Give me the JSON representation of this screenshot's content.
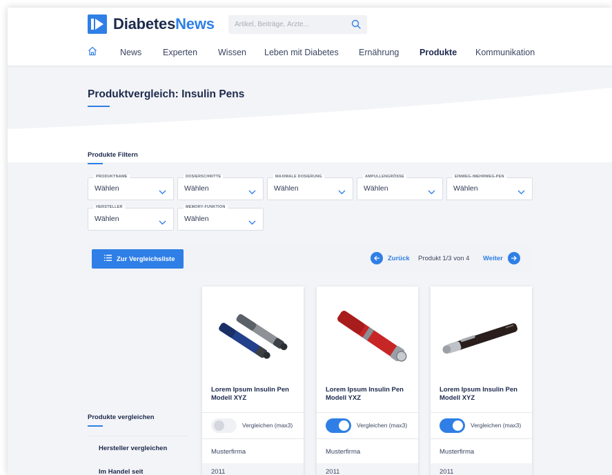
{
  "brand": {
    "name_part1": "Diabetes",
    "name_part2": "News",
    "color": "#2f7fe6"
  },
  "search": {
    "placeholder": "Artikel, Beiträge, Ärzte...",
    "icon": "search-icon"
  },
  "nav": {
    "home_icon": "home-icon",
    "items": [
      {
        "label": "News"
      },
      {
        "label": "Experten"
      },
      {
        "label": "Wissen"
      },
      {
        "label": "Leben mit Diabetes"
      },
      {
        "label": "Ernährung"
      },
      {
        "label": "Produkte",
        "active": true
      },
      {
        "label": "Kommunikation"
      }
    ]
  },
  "page": {
    "title": "Produktvergleich: Insulin Pens"
  },
  "filters": {
    "title": "Produkte Filtern",
    "items": [
      {
        "label": "PRODUKTNAME",
        "value": "Wählen"
      },
      {
        "label": "DOSIERSCHRITTE",
        "value": "Wählen"
      },
      {
        "label": "MAXIMALE DOSIERUNG",
        "value": "Wählen"
      },
      {
        "label": "AMPULLENGRÖSSE",
        "value": "Wählen"
      },
      {
        "label": "EINWEG-/MEHRWEG-PEN",
        "value": "Wählen"
      },
      {
        "label": "HERSTELLER",
        "value": "Wählen"
      },
      {
        "label": "MEMORY-FUNKTION",
        "value": "Wählen"
      }
    ]
  },
  "toolbar": {
    "compare_list_label": "Zur Vergleichsliste",
    "back_label": "Zurück",
    "pager_info": "Produkt 1/3 von 4",
    "next_label": "Weiter"
  },
  "sidebar": {
    "title": "Produkte vergleichen",
    "rows": [
      {
        "label": "Hersteller vergleichen"
      },
      {
        "label": "Im Handel seit"
      }
    ]
  },
  "products": [
    {
      "name": "Lorem Ipsum Insulin Pen Modell XYZ",
      "compare_label": "Vergleichen (max3)",
      "compare_on": false,
      "manufacturer": "Musterfirma",
      "since": "2011"
    },
    {
      "name": "Lorem Ipsum Insulin Pen Modell YXZ",
      "compare_label": "Vergleichen (max3)",
      "compare_on": true,
      "manufacturer": "Musterfirma",
      "since": "2011"
    },
    {
      "name": "Lorem Ipsum Insulin Pen Modell XYZ",
      "compare_label": "Vergleichen (max3)",
      "compare_on": true,
      "manufacturer": "Musterfirma",
      "since": "2011"
    }
  ]
}
